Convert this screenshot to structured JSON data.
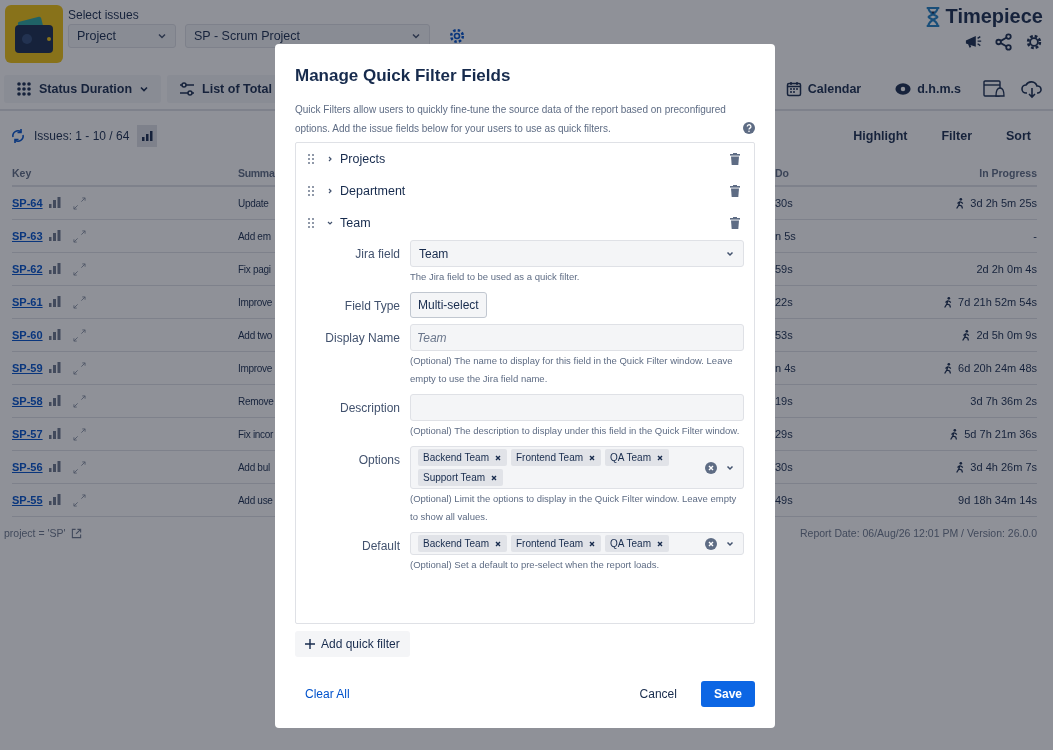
{
  "header": {
    "select_label": "Select issues",
    "scope_select": "Project",
    "project_select": "SP - Scrum Project",
    "brand": "Timepiece"
  },
  "toolbar": {
    "report_button": "Status Duration",
    "view_button": "List of Total",
    "calendar_button": "Calendar",
    "format_button": "d.h.m.s"
  },
  "summary_bar": {
    "issue_count": "Issues: 1 - 10 / 64",
    "actions": [
      "Highlight",
      "Filter",
      "Sort"
    ]
  },
  "table": {
    "columns": [
      "Key",
      "Summa",
      "Do",
      "In Progress"
    ],
    "rows": [
      {
        "key": "SP-64",
        "summary": "Update",
        "todo": "30s",
        "in_progress": "3d 2h 5m 25s",
        "running": true
      },
      {
        "key": "SP-63",
        "summary": "Add em",
        "todo": "n 5s",
        "in_progress": "-",
        "running": false
      },
      {
        "key": "SP-62",
        "summary": "Fix pagi",
        "todo": "59s",
        "in_progress": "2d 2h 0m 4s",
        "running": false
      },
      {
        "key": "SP-61",
        "summary": "Improve",
        "todo": "22s",
        "in_progress": "7d 21h 52m 54s",
        "running": true
      },
      {
        "key": "SP-60",
        "summary": "Add two",
        "todo": "53s",
        "in_progress": "2d 5h 0m 9s",
        "running": true
      },
      {
        "key": "SP-59",
        "summary": "Improve",
        "todo": "n 4s",
        "in_progress": "6d 20h 24m 48s",
        "running": true
      },
      {
        "key": "SP-58",
        "summary": "Remove",
        "todo": "19s",
        "in_progress": "3d 7h 36m 2s",
        "running": false
      },
      {
        "key": "SP-57",
        "summary": "Fix incor",
        "todo": "29s",
        "in_progress": "5d 7h 21m 36s",
        "running": true
      },
      {
        "key": "SP-56",
        "summary": "Add bul",
        "todo": "30s",
        "in_progress": "3d 4h 26m 7s",
        "running": true
      },
      {
        "key": "SP-55",
        "summary": "Add use",
        "todo": "49s",
        "in_progress": "9d 18h 34m 14s",
        "running": false
      }
    ]
  },
  "footer": {
    "query": "project = 'SP'",
    "report_info": "Report Date: 06/Aug/26 12:01 PM / Version: 26.0.0"
  },
  "dialog": {
    "title": "Manage Quick Filter Fields",
    "description": "Quick Filters allow users to quickly fine-tune the source data of the report based on preconfigured options. Add the issue fields below for your users to use as quick filters.",
    "quick_filters": [
      {
        "name": "Projects",
        "expanded": false
      },
      {
        "name": "Department",
        "expanded": false
      },
      {
        "name": "Team",
        "expanded": true,
        "fields": [
          {
            "kind": "select",
            "label": "Jira field",
            "value": "Team",
            "help": "The Jira field to be used as a quick filter."
          },
          {
            "kind": "badge",
            "label": "Field Type",
            "value": "Multi-select"
          },
          {
            "kind": "text",
            "label": "Display Name",
            "placeholder": "Team",
            "help": "(Optional) The name to display for this field in the Quick Filter window. Leave empty to use the Jira field name."
          },
          {
            "kind": "text",
            "label": "Description",
            "help": "(Optional) The description to display under this field in the Quick Filter window."
          },
          {
            "kind": "multi",
            "label": "Options",
            "tags": [
              "Backend Team",
              "Frontend Team",
              "QA Team",
              "Support Team"
            ],
            "help": "(Optional) Limit the options to display in the Quick Filter window. Leave empty to show all values."
          },
          {
            "kind": "multi",
            "label": "Default",
            "tags": [
              "Backend Team",
              "Frontend Team",
              "QA Team"
            ],
            "help": "(Optional) Set a default to pre-select when the report loads."
          }
        ]
      }
    ],
    "add_button": "Add quick filter",
    "clear_link": "Clear All",
    "cancel_button": "Cancel",
    "save_button": "Save"
  }
}
